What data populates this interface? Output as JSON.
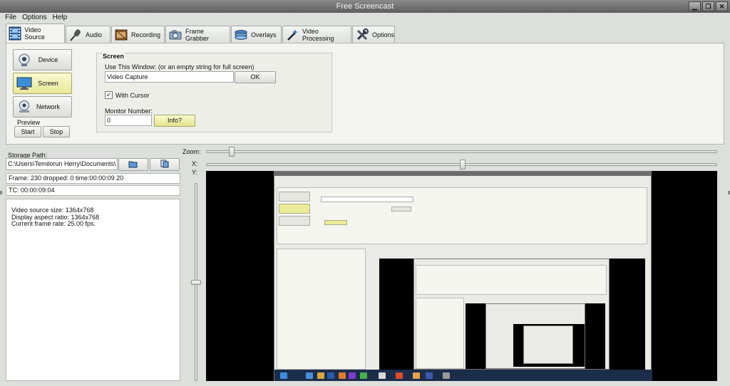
{
  "window": {
    "title": "Free Screencast",
    "controls": [
      "minimize",
      "maximize",
      "close"
    ]
  },
  "menu": [
    "File",
    "Options",
    "Help"
  ],
  "tabs": [
    {
      "label": "Video Source",
      "icon": "film-icon",
      "active": true
    },
    {
      "label": "Audio",
      "icon": "microphone-icon",
      "active": false
    },
    {
      "label": "Recording",
      "icon": "film-reel-icon",
      "active": false
    },
    {
      "label": "Frame Grabber",
      "icon": "camera-icon",
      "active": false
    },
    {
      "label": "Overlays",
      "icon": "layers-icon",
      "active": false
    },
    {
      "label": "Video Processing",
      "icon": "magic-wand-icon",
      "active": false
    },
    {
      "label": "Options",
      "icon": "tools-icon",
      "active": false
    }
  ],
  "source_buttons": [
    {
      "label": "Device",
      "icon": "webcam-icon",
      "active": false
    },
    {
      "label": "Screen",
      "icon": "monitor-icon",
      "active": true
    },
    {
      "label": "Network",
      "icon": "network-camera-icon",
      "active": false
    }
  ],
  "preview": {
    "label": "Preview",
    "start": "Start",
    "stop": "Stop"
  },
  "screen_group": {
    "title": "Screen",
    "window_label": "Use This Window:  (or an empty string for full screen)",
    "window_value": "Video Capture",
    "ok": "OK",
    "with_cursor_label": "With Cursor",
    "with_cursor_checked": true,
    "monitor_label": "Monitor Number:",
    "monitor_value": "0",
    "info": "Info?"
  },
  "storage": {
    "label": "Storage Path:",
    "path": "C:\\Users\\Temilorun Herry\\Documents\\"
  },
  "status": {
    "frame": "Frame: 230 dropped: 0 time:00:00:09 20",
    "tc": "TC: 00:00:09:04",
    "details": [
      "Video source size: 1364x768",
      "Display aspect ratio: 1364x768",
      "Current frame rate: 25.00 fps."
    ]
  },
  "sliders": {
    "zoom_label": "Zoom:",
    "x_label": "X:",
    "y_label": "Y:"
  }
}
